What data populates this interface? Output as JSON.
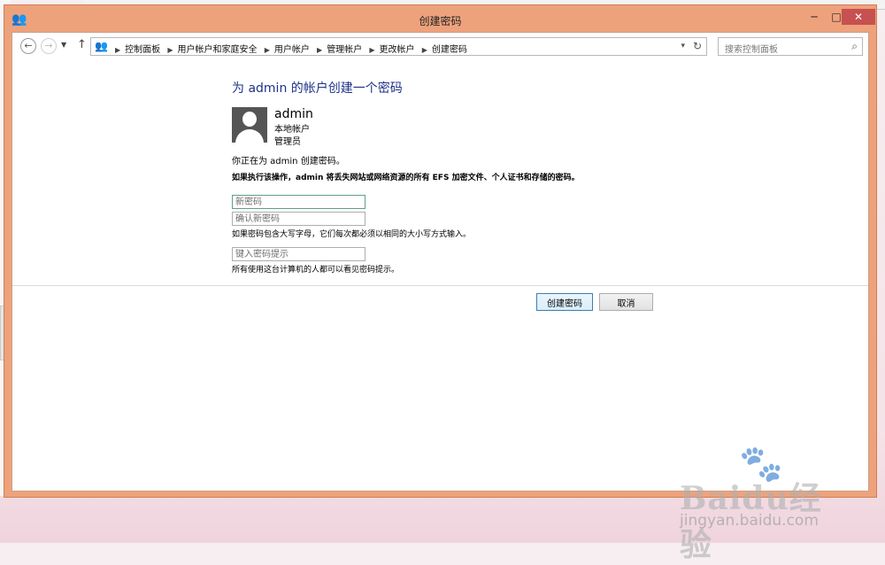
{
  "window": {
    "title": "创建密码",
    "min_glyph": "─",
    "max_glyph": "□",
    "close_glyph": "✕"
  },
  "nav": {
    "back_glyph": "←",
    "forward_glyph": "→",
    "history_glyph": "▼",
    "up_glyph": "↑",
    "breadcrumbs": [
      "控制面板",
      "用户帐户和家庭安全",
      "用户帐户",
      "管理帐户",
      "更改帐户",
      "创建密码"
    ],
    "search_placeholder": "搜索控制面板"
  },
  "page": {
    "heading": "为 admin 的帐户创建一个密码",
    "account": {
      "name": "admin",
      "type": "本地帐户",
      "role": "管理员"
    },
    "info": "你正在为 admin 创建密码。",
    "warning": "如果执行该操作，admin 将丢失网站或网络资源的所有 EFS 加密文件、个人证书和存储的密码。",
    "new_password_placeholder": "新密码",
    "confirm_password_placeholder": "确认新密码",
    "case_note": "如果密码包含大写字母，它们每次都必须以相同的大小写方式输入。",
    "hint_placeholder": "键入密码提示",
    "hint_note": "所有使用这台计算机的人都可以看见密码提示。",
    "create_button": "创建密码",
    "cancel_button": "取消"
  },
  "watermark": {
    "text": "Baidu经验",
    "url": "jingyan.baidu.com"
  },
  "colors": {
    "window_frame": "#eea27c",
    "heading": "#1e3287",
    "close_button": "#c75050"
  },
  "icons": {
    "app": "users-icon",
    "search": "search-icon",
    "refresh": "refresh-icon"
  }
}
